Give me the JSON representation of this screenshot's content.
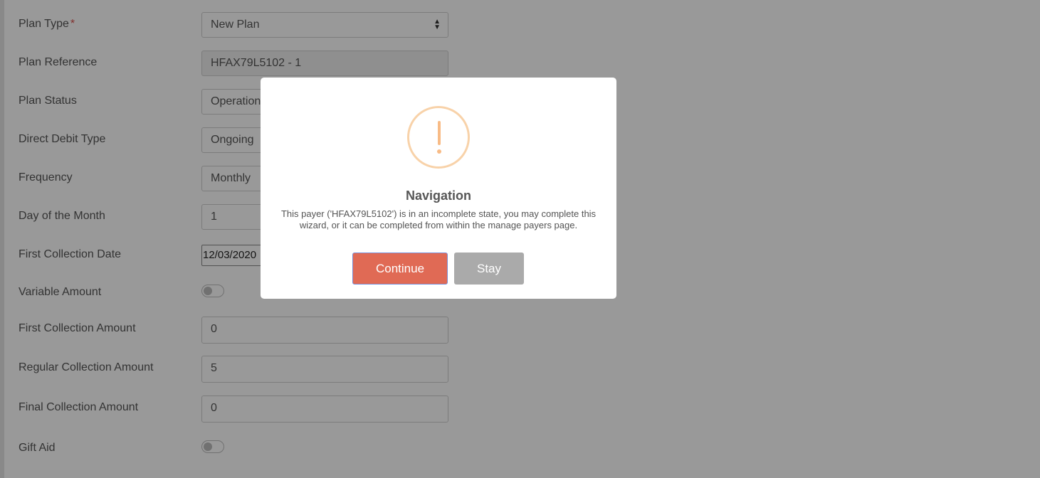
{
  "form": {
    "plan_type": {
      "label": "Plan Type",
      "required_mark": "*",
      "value": "New Plan"
    },
    "plan_reference": {
      "label": "Plan Reference",
      "value": "HFAX79L5102 - 1"
    },
    "plan_status": {
      "label": "Plan Status",
      "value": "Operational"
    },
    "direct_debit_type": {
      "label": "Direct Debit Type",
      "value": "Ongoing"
    },
    "frequency": {
      "label": "Frequency",
      "value": "Monthly"
    },
    "day_of_month": {
      "label": "Day of the Month",
      "value": "1"
    },
    "first_collection_date": {
      "label": "First Collection Date",
      "value": "12/03/2020"
    },
    "variable_amount": {
      "label": "Variable Amount",
      "enabled": false
    },
    "first_collection_amount": {
      "label": "First Collection Amount",
      "value": "0"
    },
    "regular_collection_amount": {
      "label": "Regular Collection Amount",
      "value": "5"
    },
    "final_collection_amount": {
      "label": "Final Collection Amount",
      "value": "0"
    },
    "gift_aid": {
      "label": "Gift Aid",
      "enabled": false
    }
  },
  "modal": {
    "icon": "exclamation-warning-icon",
    "icon_glyph": "!",
    "title": "Navigation",
    "message": "This payer ('HFAX79L5102') is in an incomplete state, you may complete this wizard, or it can be completed from within the manage payers page.",
    "continue_label": "Continue",
    "stay_label": "Stay"
  },
  "colors": {
    "continue_button": "#e06a55",
    "stay_button": "#aaaaaa",
    "warning_icon": "#f8bb86",
    "required_mark": "#d9534f"
  }
}
